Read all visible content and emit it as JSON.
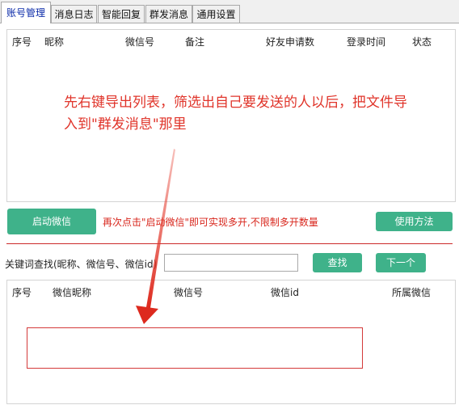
{
  "tabs": [
    {
      "label": "账号管理",
      "active": true
    },
    {
      "label": "消息日志",
      "active": false
    },
    {
      "label": "智能回复",
      "active": false
    },
    {
      "label": "群发消息",
      "active": false
    },
    {
      "label": "通用设置",
      "active": false
    }
  ],
  "accounts_table": {
    "columns": [
      "序号",
      "昵称",
      "微信号",
      "备注",
      "好友申请数",
      "登录时间",
      "状态"
    ]
  },
  "annotation_text": "先右键导出列表，筛选出自己要发送的人以后，把文件导入到\"群发消息\"那里",
  "buttons": {
    "start_wechat": "启动微信",
    "usage": "使用方法",
    "search": "查找",
    "next": "下一个"
  },
  "multi_open_note": "再次点击\"启动微信\"即可实现多开,不限制多开数量",
  "search": {
    "label": "关键词查找(昵称、微信号、微信id)",
    "value": ""
  },
  "results_table": {
    "columns": [
      "序号",
      "微信昵称",
      "微信号",
      "微信id",
      "所属微信"
    ]
  },
  "colors": {
    "accent_green": "#3fb28a",
    "annotation_red": "#e0342a",
    "active_tab_text": "#0a2aa8"
  }
}
